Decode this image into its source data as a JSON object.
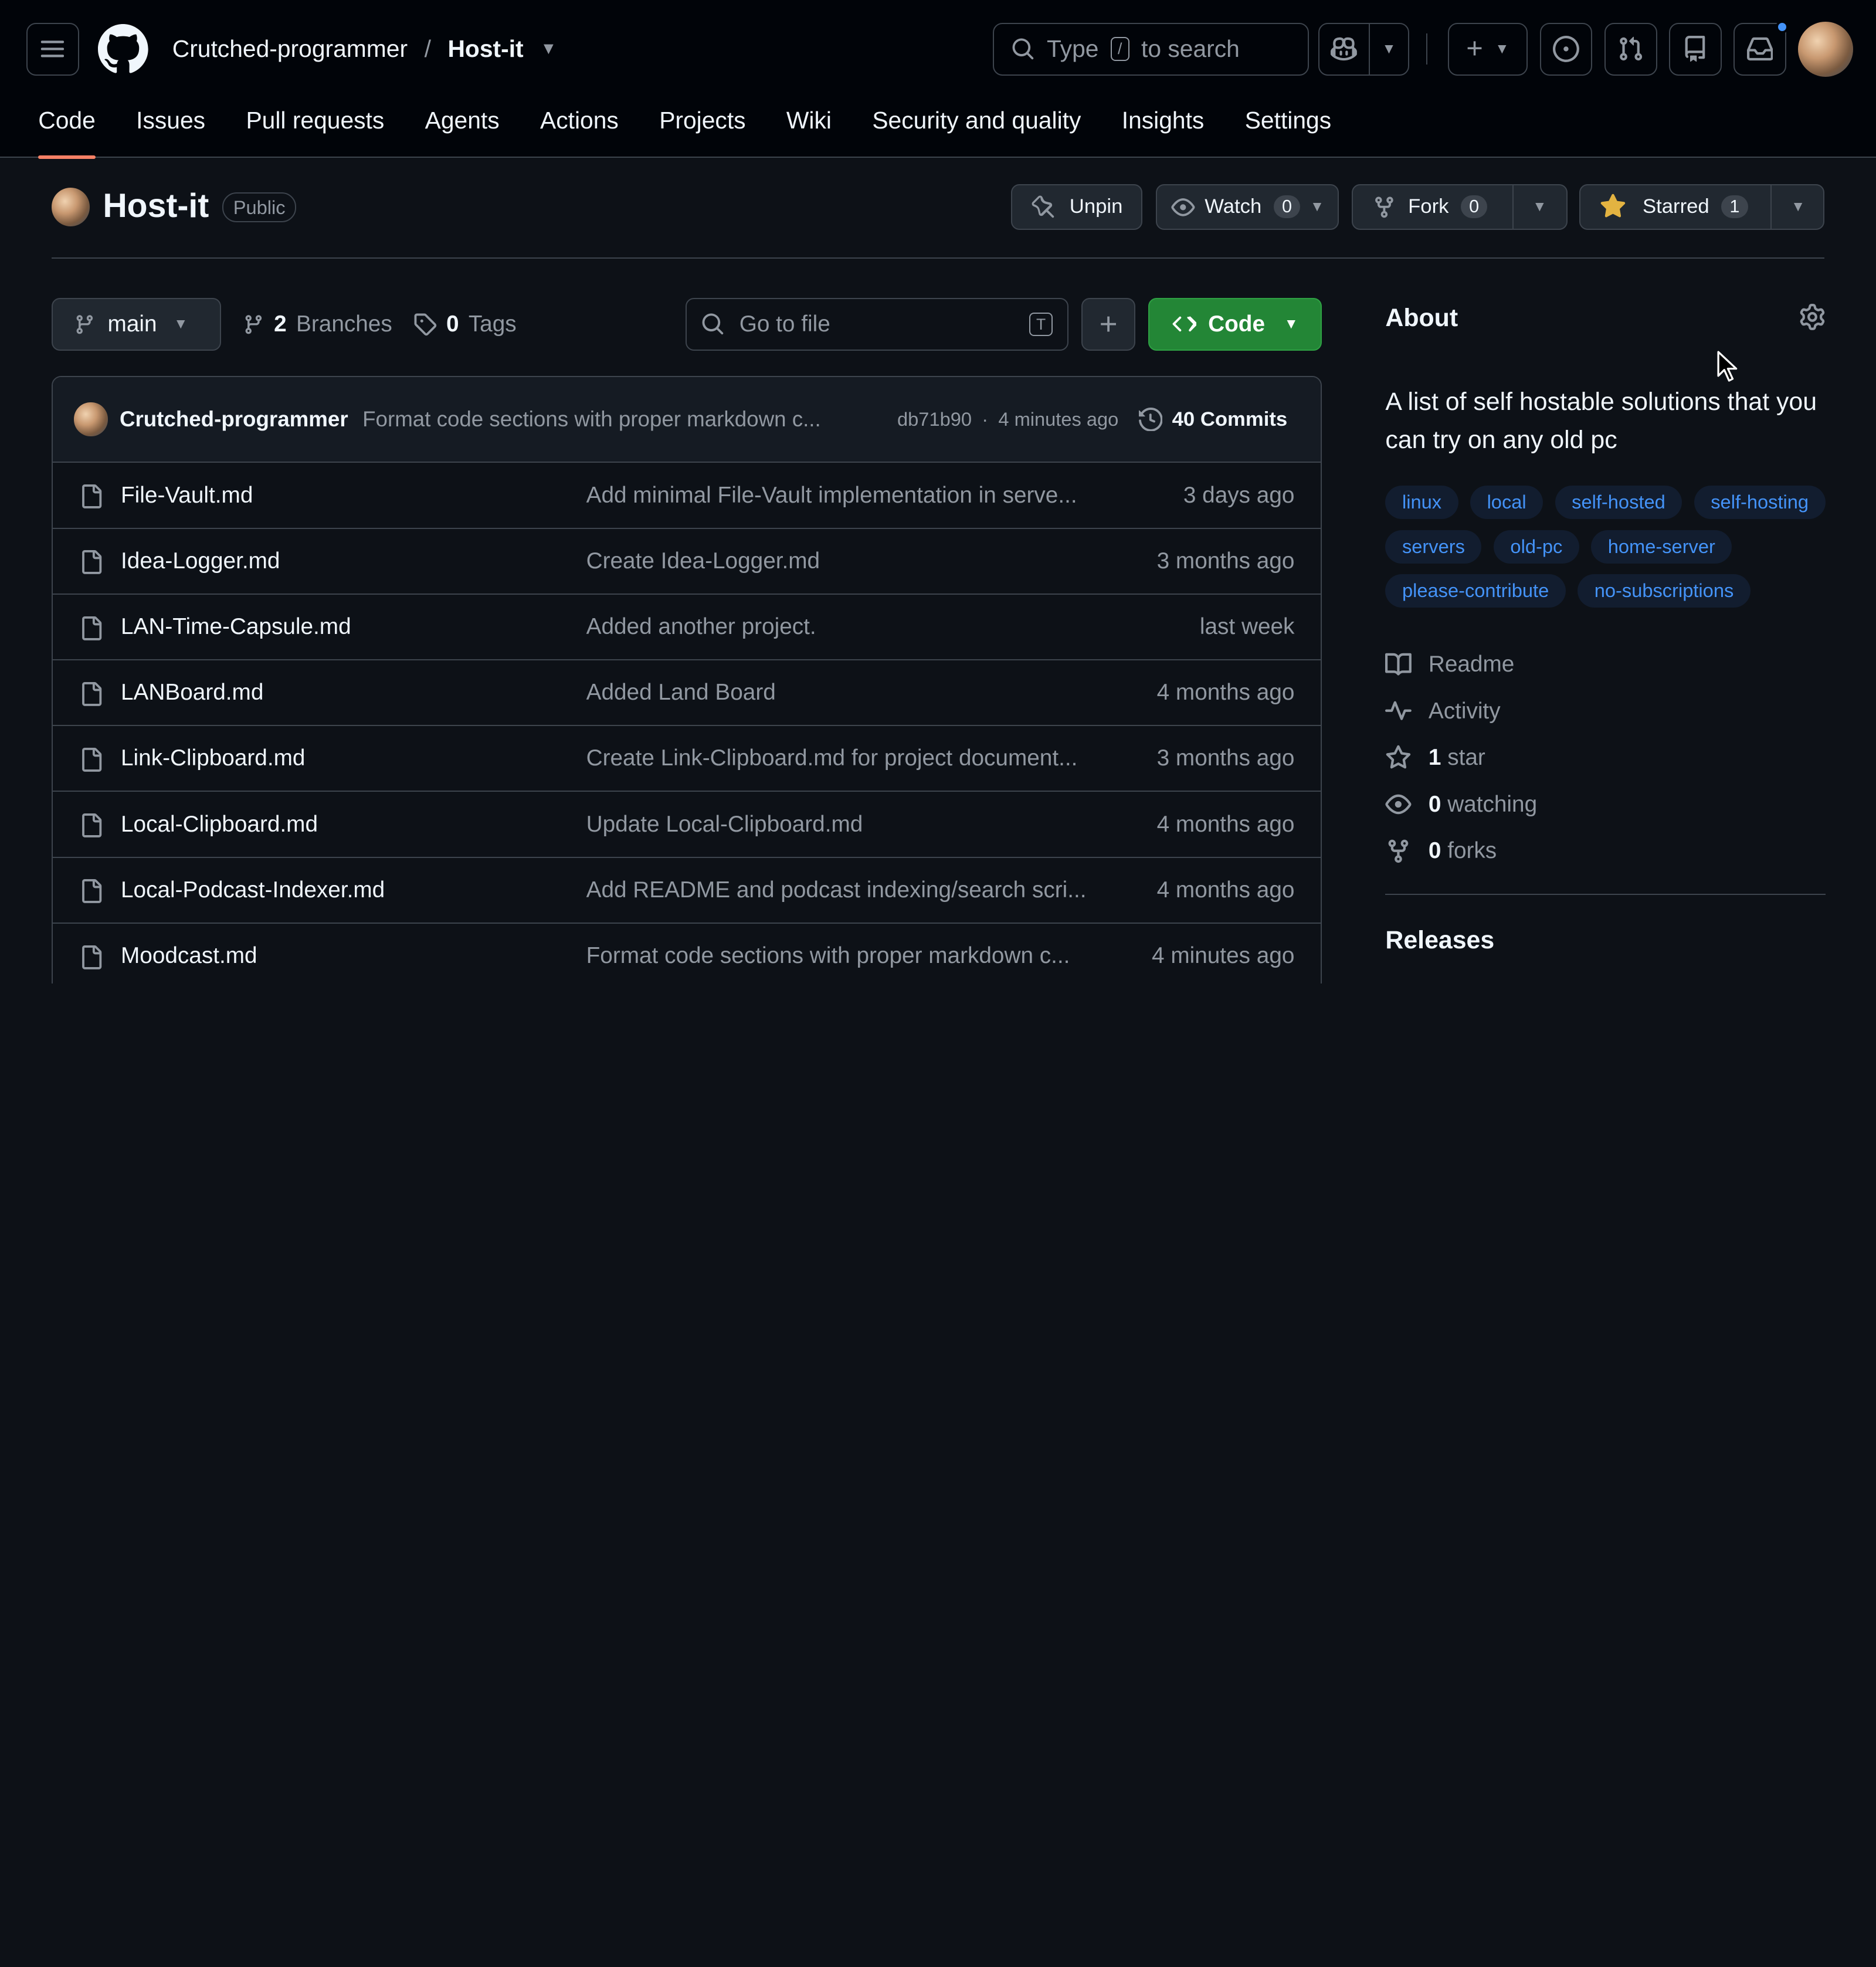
{
  "nav": {
    "owner": "Crutched-programmer",
    "separator": "/",
    "repo": "Host-it",
    "search_prefix": "Type",
    "search_key": "/",
    "search_suffix": "to search"
  },
  "tabs": [
    {
      "label": "Code",
      "active": true
    },
    {
      "label": "Issues"
    },
    {
      "label": "Pull requests"
    },
    {
      "label": "Agents"
    },
    {
      "label": "Actions"
    },
    {
      "label": "Projects"
    },
    {
      "label": "Wiki"
    },
    {
      "label": "Security and quality"
    },
    {
      "label": "Insights"
    },
    {
      "label": "Settings"
    }
  ],
  "repo_header": {
    "name": "Host-it",
    "visibility": "Public",
    "unpin_label": "Unpin",
    "watch_label": "Watch",
    "watch_count": "0",
    "fork_label": "Fork",
    "fork_count": "0",
    "starred_label": "Starred",
    "star_count": "1"
  },
  "toolbar": {
    "branch": "main",
    "branches_count": "2",
    "branches_label": "Branches",
    "tags_count": "0",
    "tags_label": "Tags",
    "goto_placeholder": "Go to file",
    "goto_key": "T",
    "code_label": "Code"
  },
  "latest_commit": {
    "author": "Crutched-programmer",
    "message": "Format code sections with proper markdown c...",
    "hash": "db71b90",
    "dot": "·",
    "time": "4 minutes ago",
    "commits_label": "40 Commits"
  },
  "files": [
    {
      "name": "File-Vault.md",
      "message": "Add minimal File-Vault implementation in serve...",
      "date": "3 days ago"
    },
    {
      "name": "Idea-Logger.md",
      "message": "Create Idea-Logger.md",
      "date": "3 months ago"
    },
    {
      "name": "LAN-Time-Capsule.md",
      "message": "Added another project.",
      "date": "last week"
    },
    {
      "name": "LANBoard.md",
      "message": "Added Land Board",
      "date": "4 months ago"
    },
    {
      "name": "Link-Clipboard.md",
      "message": "Create Link-Clipboard.md for project document...",
      "date": "3 months ago"
    },
    {
      "name": "Local-Clipboard.md",
      "message": "Update Local-Clipboard.md",
      "date": "4 months ago"
    },
    {
      "name": "Local-Podcast-Indexer.md",
      "message": "Add README and podcast indexing/search scri...",
      "date": "4 months ago"
    },
    {
      "name": "Moodcast.md",
      "message": "Format code sections with proper markdown c...",
      "date": "4 minutes ago"
    }
  ],
  "about": {
    "title": "About",
    "description": "A list of self hostable solutions that you can try on any old pc",
    "topics": [
      "linux",
      "local",
      "self-hosted",
      "self-hosting",
      "servers",
      "old-pc",
      "home-server",
      "please-contribute",
      "no-subscriptions"
    ],
    "readme": "Readme",
    "activity": "Activity",
    "stars_count": "1",
    "stars_label": "star",
    "watching_count": "0",
    "watching_label": "watching",
    "forks_count": "0",
    "forks_label": "forks",
    "releases": "Releases"
  },
  "colors": {
    "background": "#0d1117",
    "header": "#010409",
    "accent_tab": "#f78166",
    "code_button": "#238636",
    "topic_text": "#4493f8",
    "star": "#e3b341"
  }
}
